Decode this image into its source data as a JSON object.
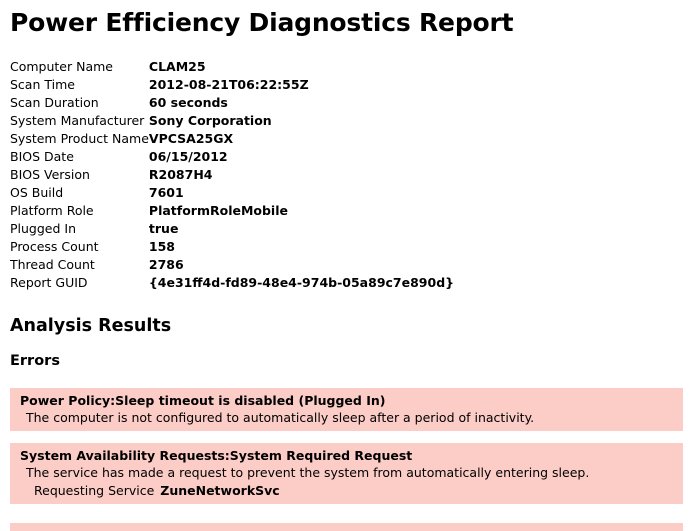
{
  "report": {
    "title": "Power Efficiency Diagnostics Report"
  },
  "system_info": {
    "rows": [
      {
        "label": "Computer Name",
        "value": "CLAM25"
      },
      {
        "label": "Scan Time",
        "value": "2012-08-21T06:22:55Z"
      },
      {
        "label": "Scan Duration",
        "value": "60 seconds"
      },
      {
        "label": "System Manufacturer",
        "value": "Sony Corporation"
      },
      {
        "label": "System Product Name",
        "value": "VPCSA25GX"
      },
      {
        "label": "BIOS Date",
        "value": "06/15/2012"
      },
      {
        "label": "BIOS Version",
        "value": "R2087H4"
      },
      {
        "label": "OS Build",
        "value": "7601"
      },
      {
        "label": "Platform Role",
        "value": "PlatformRoleMobile"
      },
      {
        "label": "Plugged In",
        "value": "true"
      },
      {
        "label": "Process Count",
        "value": "158"
      },
      {
        "label": "Thread Count",
        "value": "2786"
      },
      {
        "label": "Report GUID",
        "value": "{4e31ff4d-fd89-48e4-974b-05a89c7e890d}"
      }
    ]
  },
  "analysis": {
    "heading": "Analysis Results",
    "errors_heading": "Errors",
    "errors": [
      {
        "title": "Power Policy:Sleep timeout is disabled (Plugged In)",
        "description": "The computer is not configured to automatically sleep after a period of inactivity."
      },
      {
        "title": "System Availability Requests:System Required Request",
        "description": "The service has made a request to prevent the system from automatically entering sleep.",
        "detail_label": "Requesting Service",
        "detail_value": "ZuneNetworkSvc"
      }
    ]
  },
  "colors": {
    "error_background": "#fcccc6",
    "page_background": "#ffffff",
    "text": "#000000"
  }
}
